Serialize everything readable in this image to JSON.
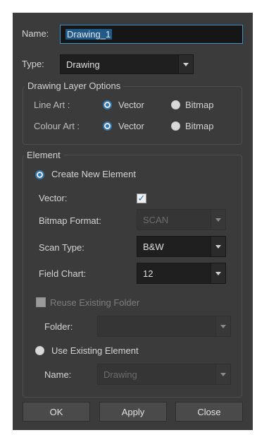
{
  "dialog": {
    "name_label": "Name:",
    "name_value": "Drawing_1",
    "type_label": "Type:",
    "type_value": "Drawing"
  },
  "drawing_layer_options": {
    "title": "Drawing Layer Options",
    "line_art_label": "Line Art :",
    "line_art_options": [
      "Vector",
      "Bitmap"
    ],
    "line_art_selected": "Vector",
    "colour_art_label": "Colour Art :",
    "colour_art_options": [
      "Vector",
      "Bitmap"
    ],
    "colour_art_selected": "Vector"
  },
  "element": {
    "title": "Element",
    "create_new_label": "Create New Element",
    "create_new_selected": true,
    "vector_label": "Vector:",
    "vector_checked": true,
    "bitmap_format_label": "Bitmap Format:",
    "bitmap_format_value": "SCAN",
    "scan_type_label": "Scan Type:",
    "scan_type_value": "B&W",
    "field_chart_label": "Field Chart:",
    "field_chart_value": "12",
    "reuse_folder_label": "Reuse Existing Folder",
    "folder_label": "Folder:",
    "folder_value": "",
    "use_existing_label": "Use Existing Element",
    "existing_name_label": "Name:",
    "existing_name_value": "Drawing"
  },
  "buttons": {
    "ok": "OK",
    "apply": "Apply",
    "close": "Close"
  },
  "colors": {
    "dialog_bg": "#3b3b3b",
    "accent": "#2f76ad",
    "focus_border": "#3c8fc7"
  }
}
